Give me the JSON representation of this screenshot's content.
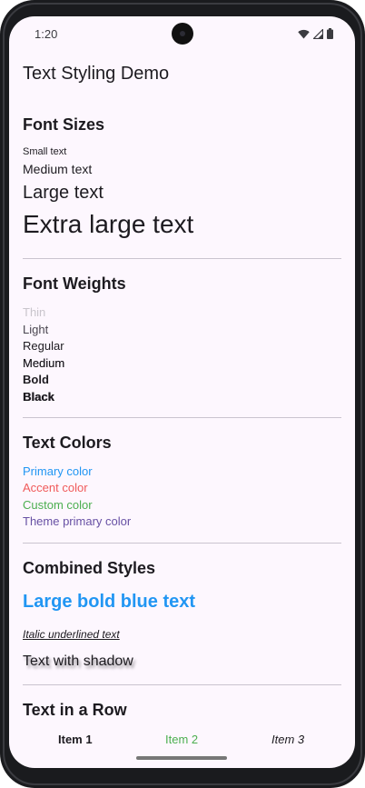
{
  "status_bar": {
    "time": "1:20",
    "icons": [
      "wifi-icon",
      "cellular-signal-icon",
      "battery-icon"
    ]
  },
  "app": {
    "title": "Text Styling Demo"
  },
  "sections": {
    "font_sizes": {
      "title": "Font Sizes",
      "items": [
        "Small text",
        "Medium text",
        "Large text",
        "Extra large text"
      ]
    },
    "font_weights": {
      "title": "Font Weights",
      "items": [
        "Thin",
        "Light",
        "Regular",
        "Medium",
        "Bold",
        "Black"
      ]
    },
    "text_colors": {
      "title": "Text Colors",
      "items": [
        "Primary color",
        "Accent color",
        "Custom color",
        "Theme primary color"
      ],
      "colors": [
        "#2196f3",
        "#f05a5a",
        "#4caf50",
        "#6750a4"
      ]
    },
    "combined_styles": {
      "title": "Combined Styles",
      "large_bold_blue": "Large bold blue text",
      "italic_underlined": "Italic underlined text",
      "shadow": "Text with shadow",
      "blue_color": "#2196f3"
    },
    "text_in_row": {
      "title": "Text in a Row",
      "items": [
        "Item 1",
        "Item 2",
        "Item 3"
      ],
      "item2_color": "#4caf50"
    }
  }
}
